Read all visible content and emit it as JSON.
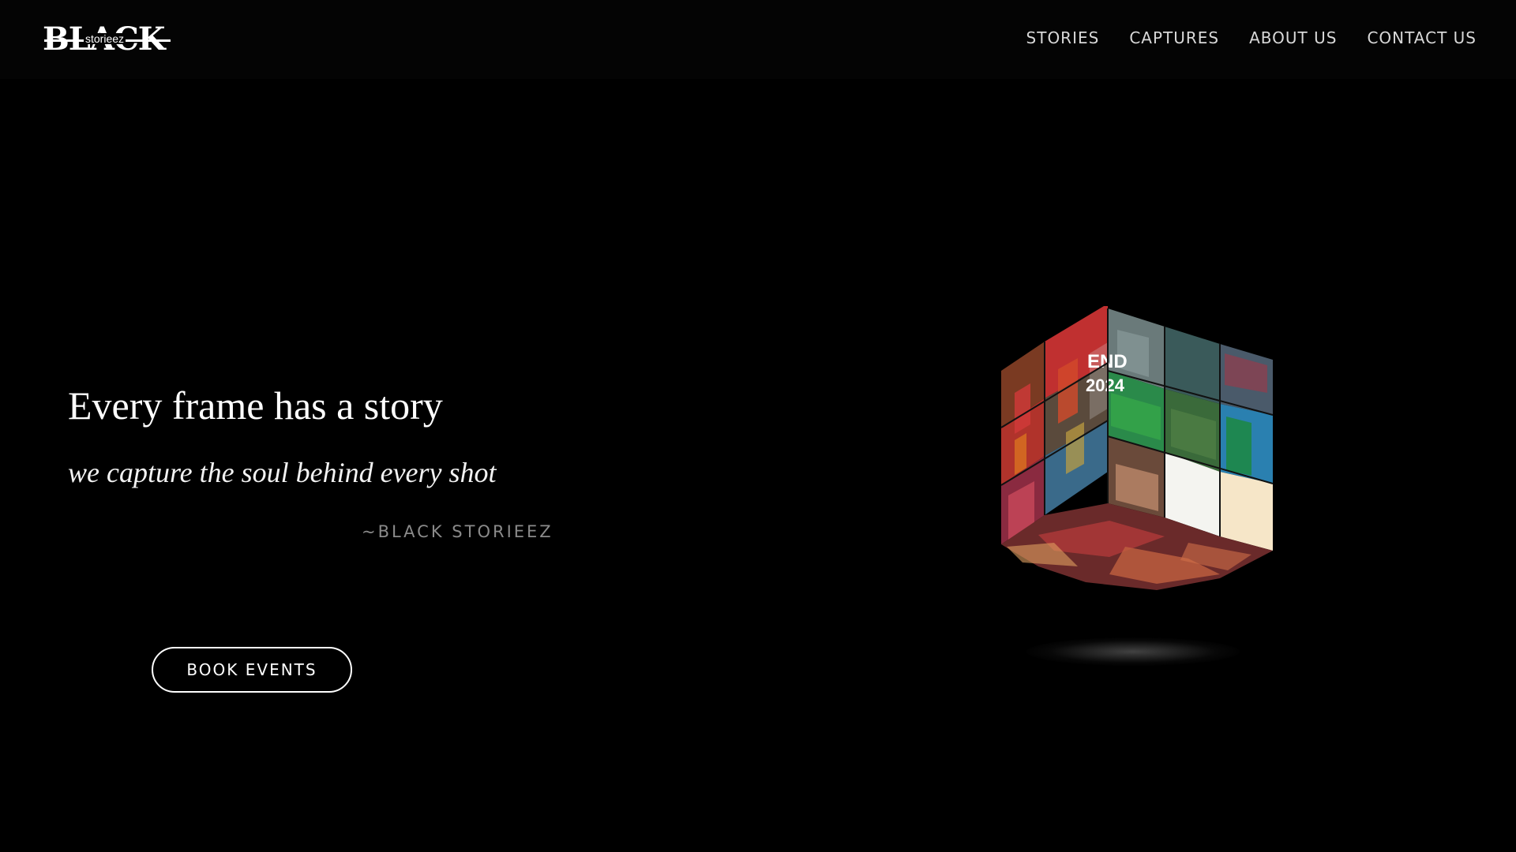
{
  "header": {
    "logo": {
      "main_text": "BLACK",
      "sub_text": "storieez"
    },
    "nav": [
      {
        "label": "STORIES"
      },
      {
        "label": "CAPTURES"
      },
      {
        "label": "ABOUT US"
      },
      {
        "label": "CONTACT US"
      }
    ]
  },
  "hero": {
    "title": "Every frame has a story",
    "subtitle": "we capture the soul behind every shot",
    "signature": "~BLACK STORIEEZ",
    "cta_label": "BOOK EVENTS"
  },
  "cube": {
    "tile_texts": [
      "END",
      "2024"
    ]
  },
  "colors": {
    "background": "#000000",
    "header_bg": "#040404",
    "nav_text": "#d8d8d8",
    "signature_text": "#8a8a8a",
    "accent": "#ffffff"
  }
}
